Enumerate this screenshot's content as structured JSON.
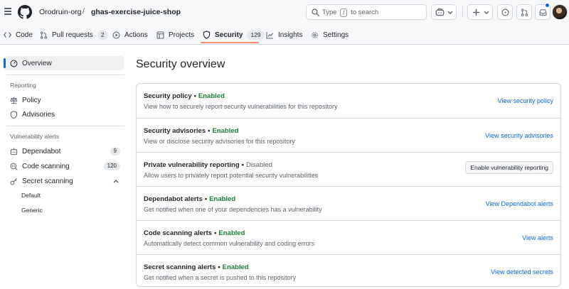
{
  "header": {
    "org": "Orodruin-org",
    "separator": "/",
    "repo": "ghas-exercise-juice-shop",
    "search_prefix": "Type",
    "search_key": "/",
    "search_suffix": "to search"
  },
  "tabs": [
    {
      "label": "Code"
    },
    {
      "label": "Pull requests",
      "count": "2"
    },
    {
      "label": "Actions"
    },
    {
      "label": "Projects"
    },
    {
      "label": "Security",
      "count": "129"
    },
    {
      "label": "Insights"
    },
    {
      "label": "Settings"
    }
  ],
  "sidebar": {
    "overview": "Overview",
    "reporting_heading": "Reporting",
    "policy": "Policy",
    "advisories": "Advisories",
    "vuln_heading": "Vulnerability alerts",
    "dependabot": "Dependabot",
    "dependabot_count": "9",
    "code_scanning": "Code scanning",
    "code_scanning_count": "120",
    "secret_scanning": "Secret scanning",
    "default": "Default",
    "generic": "Generic"
  },
  "main": {
    "title": "Security overview",
    "rows": [
      {
        "title": "Security policy",
        "sep": "•",
        "status": "Enabled",
        "desc": "View how to securely report security vulnerabilities for this repository",
        "action": "View security policy"
      },
      {
        "title": "Security advisories",
        "sep": "•",
        "status": "Enabled",
        "desc": "View or disclose security advisories for this repository",
        "action": "View security advisories"
      },
      {
        "title": "Private vulnerability reporting",
        "sep": "•",
        "status": "Disabled",
        "desc": "Allow users to privately report potential security vulnerabilities",
        "action": "Enable vulnerability reporting"
      },
      {
        "title": "Dependabot alerts",
        "sep": "•",
        "status": "Enabled",
        "desc": "Get notified when one of your dependencies has a vulnerability",
        "action": "View Dependabot alerts"
      },
      {
        "title": "Code scanning alerts",
        "sep": "•",
        "status": "Enabled",
        "desc": "Automatically detect common vulnerability and coding errors",
        "action": "View alerts"
      },
      {
        "title": "Secret scanning alerts",
        "sep": "•",
        "status": "Enabled",
        "desc": "Get notified when a secret is pushed to this repository",
        "action": "View detected secrets"
      }
    ]
  },
  "colors": {
    "accent": "#0969da",
    "enabled": "#1a7f37",
    "tab_underline": "#fd8c73"
  }
}
